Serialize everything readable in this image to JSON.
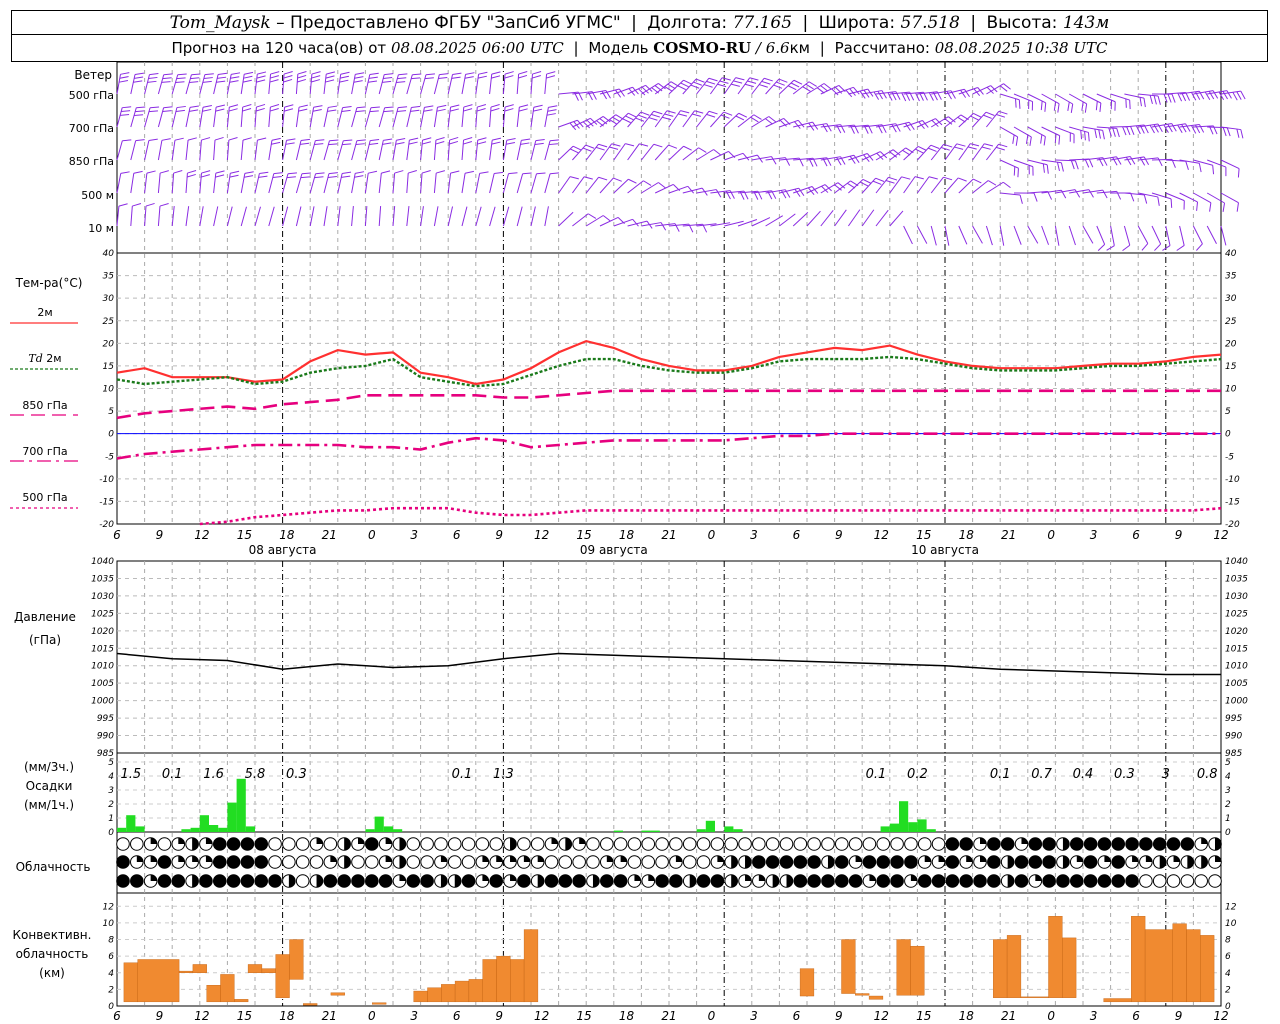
{
  "header": {
    "station": "Tom_Maysk",
    "provider": "– Предоставлено ФГБУ \"ЗапСиб УГМС\"",
    "lon_label": "Долгота:",
    "lon": "77.165",
    "lat_label": "Широта:",
    "lat": "57.518",
    "alt_label": "Высота:",
    "alt": "143м",
    "forecast_label": "Прогноз на 120 часа(ов) от",
    "forecast_from": "08.08.2025 06:00 UTC",
    "model_label": "Модель",
    "model_name": "COSMO-RU",
    "model_res": "/ 6.6",
    "model_res_unit": "км",
    "calc_label": "Рассчитано:",
    "calc_time": "08.08.2025 10:38 UTC"
  },
  "labels": {
    "wind": "Ветер",
    "wind_levels": [
      "500 гПа",
      "700 гПа",
      "850 гПа",
      "500 м",
      "10 м"
    ],
    "temp_title": "Тем-ра(°С)",
    "temp_2m": "2м",
    "td_2m_prefix": "Td",
    "td_2m": "2м",
    "t850": "850 гПа",
    "t700": "700 гПа",
    "t500": "500 гПа",
    "pressure": "Давление",
    "pressure_unit": "(гПа)",
    "precip_unit3": "(мм/3ч.)",
    "precip": "Осадки",
    "precip_unit1": "(мм/1ч.)",
    "cloud": "Облачность",
    "conv1": "Конвективн.",
    "conv2": "облачность",
    "conv3": "(км)"
  },
  "colors": {
    "wind": "#8a2be2",
    "t2m": "#ff3030",
    "td2m": "#1a7a1a",
    "t850": "#e6007e",
    "t700": "#e6007e",
    "t500": "#e6007e",
    "zero_line": "#0000ff",
    "pressure": "#000000",
    "precip": "#22dd22",
    "convective": "#f08a30"
  },
  "chart_data": [
    {
      "type": "line",
      "title": "Тем-ра(°С)",
      "x_hours": [
        0,
        3,
        6,
        9,
        12,
        15,
        18,
        21,
        24,
        27,
        30,
        33,
        36,
        39,
        42,
        45,
        48,
        51,
        54,
        57,
        60,
        63,
        66,
        69,
        72,
        75,
        78,
        81,
        84,
        87,
        90,
        93,
        96,
        99,
        102,
        105,
        108,
        111,
        114,
        117,
        120
      ],
      "x_tick_labels": [
        "6",
        "9",
        "12",
        "15",
        "18",
        "21",
        "0",
        "3",
        "6",
        "9",
        "12",
        "15",
        "18",
        "21",
        "0",
        "3",
        "6",
        "9",
        "12",
        "15",
        "18",
        "21",
        "0",
        "3",
        "6",
        "9",
        "12"
      ],
      "date_labels": [
        "08 августа",
        "09 августа",
        "10 августа"
      ],
      "ylim": [
        -20,
        40
      ],
      "y_ticks": [
        -20,
        -15,
        -10,
        -5,
        0,
        5,
        10,
        15,
        20,
        25,
        30,
        35,
        40
      ],
      "series": [
        {
          "name": "2м",
          "values": [
            13.5,
            14.5,
            12.5,
            12.5,
            12.5,
            11.5,
            12,
            16,
            18.5,
            17.5,
            18,
            13.5,
            12.5,
            11,
            12,
            14.5,
            18,
            20.5,
            19,
            16.5,
            15,
            14,
            14,
            15,
            17,
            18,
            19,
            18.5,
            19.5,
            17.5,
            16,
            15,
            14.5,
            14.5,
            14.5,
            15,
            15.5,
            15.5,
            16,
            17,
            17.5
          ]
        },
        {
          "name": "Td 2м",
          "values": [
            12,
            11,
            11.5,
            12,
            12.5,
            11,
            11.5,
            13.5,
            14.5,
            15,
            16.5,
            12.5,
            11.5,
            10.5,
            11,
            13,
            15,
            16.5,
            16.5,
            15,
            14,
            13.5,
            13.5,
            14.5,
            16,
            16.5,
            16.5,
            16.5,
            17,
            16.5,
            15.5,
            14.5,
            14,
            14,
            14,
            14.5,
            15,
            15,
            15.5,
            16,
            16.5
          ]
        },
        {
          "name": "850 гПа",
          "values": [
            3.5,
            4.5,
            5,
            5.5,
            6,
            5.5,
            6.5,
            7,
            7.5,
            8.5,
            8.5,
            8.5,
            8.5,
            8.5,
            8,
            8,
            8.5,
            9,
            9.5,
            9.5,
            9.5,
            9.5,
            9.5,
            9.5,
            9.5,
            9.5,
            9.5,
            9.5,
            9.5,
            9.5,
            9.5,
            9.5,
            9.5,
            9.5,
            9.5,
            9.5,
            9.5,
            9.5,
            9.5,
            9.5,
            9.5
          ]
        },
        {
          "name": "700 гПа",
          "values": [
            -5.5,
            -4.5,
            -4,
            -3.5,
            -3,
            -2.5,
            -2.5,
            -2.5,
            -2.5,
            -3,
            -3,
            -3.5,
            -2,
            -1,
            -1.5,
            -3,
            -2.5,
            -2,
            -1.5,
            -1.5,
            -1.5,
            -1.5,
            -1.5,
            -1,
            -0.5,
            -0.5,
            0,
            0,
            0,
            0,
            0,
            0,
            0,
            0,
            0,
            0,
            0,
            0,
            0,
            0,
            0
          ]
        },
        {
          "name": "500 гПа",
          "values": [
            null,
            null,
            null,
            -20,
            -19.5,
            -18.5,
            -18,
            -17.5,
            -17,
            -17,
            -16.5,
            -16.5,
            -16.5,
            -17.5,
            -18,
            -18,
            -17.5,
            -17,
            -17,
            -17,
            -17,
            -17,
            -17,
            -17,
            -17,
            -17,
            -17,
            -17,
            -17,
            -17,
            -17,
            -17,
            -17,
            -17,
            -17,
            -17,
            -17,
            -17,
            -17,
            -17,
            -16.5
          ]
        }
      ]
    },
    {
      "type": "line",
      "title": "Давление (гПа)",
      "x_hours": [
        0,
        6,
        12,
        18,
        24,
        30,
        36,
        42,
        48,
        54,
        60,
        66,
        72,
        78,
        84,
        90,
        96,
        102,
        108,
        114,
        120
      ],
      "ylim": [
        985,
        1040
      ],
      "y_ticks": [
        985,
        990,
        995,
        1000,
        1005,
        1010,
        1015,
        1020,
        1025,
        1030,
        1035,
        1040
      ],
      "series": [
        {
          "name": "Давление",
          "values": [
            1013.5,
            1012,
            1011.5,
            1009,
            1010.5,
            1009.5,
            1010,
            1012,
            1013.5,
            1013,
            1012.5,
            1012,
            1011.5,
            1011,
            1010.5,
            1010,
            1009,
            1008.5,
            1008,
            1007.5,
            1007.5
          ]
        }
      ]
    },
    {
      "type": "bar",
      "title": "Осадки (мм/1ч.)",
      "ylim": [
        0,
        5
      ],
      "y_ticks": [
        0,
        1,
        2,
        3,
        4,
        5
      ],
      "x_hours": [
        0,
        1,
        2,
        3,
        6,
        7,
        8,
        9,
        10,
        11,
        12,
        13,
        14,
        15,
        27,
        28,
        29,
        30,
        54,
        55,
        57,
        58,
        63,
        64,
        65,
        66,
        67,
        68,
        69,
        70,
        71,
        72,
        73,
        74,
        75,
        76,
        77,
        78,
        79,
        80,
        81,
        82,
        83,
        84,
        85,
        86,
        87,
        88,
        89,
        90,
        91,
        92,
        93,
        94,
        95,
        96,
        97,
        98,
        99,
        100,
        101,
        102,
        103,
        104,
        105,
        106,
        107,
        108,
        109,
        110,
        111,
        112,
        113,
        114,
        115,
        116,
        117,
        118,
        119
      ],
      "values": [
        0.3,
        1.2,
        0.4,
        0,
        0,
        0.2,
        0.3,
        1.2,
        0.5,
        0.3,
        2.1,
        3.8,
        0.4,
        0,
        0.2,
        1.1,
        0.4,
        0.2,
        0.1,
        0,
        0.1,
        0.1,
        0.2,
        0.8,
        0,
        0.4,
        0.2,
        0,
        0,
        0,
        0,
        0,
        0,
        0,
        0,
        0,
        0,
        0,
        0,
        0,
        0,
        0,
        0.4,
        0.6,
        2.2,
        0.7,
        0.9,
        0.2,
        0,
        0,
        0,
        0,
        0,
        0,
        0,
        0,
        0,
        0,
        0,
        0,
        0,
        0,
        0,
        0,
        0,
        0,
        0,
        0,
        0,
        0,
        0,
        0,
        0,
        0,
        0,
        0,
        0,
        0,
        0
      ],
      "totals_3h_labels": [
        "1.5",
        "0.1",
        "1.6",
        "5.8",
        "0.3",
        "0.1",
        "1.3",
        "0.1",
        "0.2",
        "0.1",
        "0.7",
        "0.4",
        "0.3",
        "3",
        "0.8"
      ],
      "totals_3h_hours": [
        1,
        4,
        7,
        10,
        13,
        25,
        28,
        55,
        58,
        64,
        67,
        70,
        73,
        76,
        79
      ]
    },
    {
      "type": "bar",
      "title": "Конвективн. облачность (км)",
      "ylim": [
        0,
        13
      ],
      "y_ticks": [
        0,
        2,
        4,
        6,
        8,
        10,
        12
      ],
      "bars": [
        {
          "x0": 0.5,
          "x1": 1.5,
          "bot": 0.5,
          "top": 5.2
        },
        {
          "x0": 1.5,
          "x1": 4.5,
          "bot": 0.5,
          "top": 5.6
        },
        {
          "x0": 4.5,
          "x1": 5.5,
          "bot": 4.0,
          "top": 4.2
        },
        {
          "x0": 5.5,
          "x1": 6.5,
          "bot": 4.0,
          "top": 5.0
        },
        {
          "x0": 6.5,
          "x1": 7.5,
          "bot": 0.5,
          "top": 2.5
        },
        {
          "x0": 7.5,
          "x1": 8.5,
          "bot": 0.5,
          "top": 3.8
        },
        {
          "x0": 8.5,
          "x1": 9.5,
          "bot": 0.5,
          "top": 0.8
        },
        {
          "x0": 9.5,
          "x1": 10.5,
          "bot": 4.0,
          "top": 5.0
        },
        {
          "x0": 10.5,
          "x1": 11.5,
          "bot": 4.0,
          "top": 4.5
        },
        {
          "x0": 11.5,
          "x1": 12.5,
          "bot": 1.0,
          "top": 6.2
        },
        {
          "x0": 12.5,
          "x1": 13.5,
          "bot": 3.2,
          "top": 8.0
        },
        {
          "x0": 13.5,
          "x1": 14.5,
          "bot": 0.1,
          "top": 0.3
        },
        {
          "x0": 15.5,
          "x1": 16.5,
          "bot": 1.3,
          "top": 1.6
        },
        {
          "x0": 18.5,
          "x1": 19.5,
          "bot": 0.2,
          "top": 0.4
        },
        {
          "x0": 21.5,
          "x1": 22.5,
          "bot": 0.5,
          "top": 1.8
        },
        {
          "x0": 22.5,
          "x1": 23.5,
          "bot": 0.5,
          "top": 2.2
        },
        {
          "x0": 23.5,
          "x1": 24.5,
          "bot": 0.5,
          "top": 2.6
        },
        {
          "x0": 24.5,
          "x1": 25.5,
          "bot": 0.5,
          "top": 3.0
        },
        {
          "x0": 25.5,
          "x1": 26.5,
          "bot": 0.5,
          "top": 3.2
        },
        {
          "x0": 26.5,
          "x1": 27.5,
          "bot": 0.5,
          "top": 5.6
        },
        {
          "x0": 27.5,
          "x1": 28.5,
          "bot": 0.5,
          "top": 6.0
        },
        {
          "x0": 28.5,
          "x1": 29.5,
          "bot": 0.5,
          "top": 5.6
        },
        {
          "x0": 29.5,
          "x1": 30.5,
          "bot": 0.5,
          "top": 9.2
        },
        {
          "x0": 49.5,
          "x1": 50.5,
          "bot": 1.2,
          "top": 4.5
        },
        {
          "x0": 52.5,
          "x1": 53.5,
          "bot": 1.5,
          "top": 8.0
        },
        {
          "x0": 53.5,
          "x1": 54.5,
          "bot": 1.3,
          "top": 1.5
        },
        {
          "x0": 54.5,
          "x1": 55.5,
          "bot": 0.8,
          "top": 1.2
        },
        {
          "x0": 56.5,
          "x1": 57.5,
          "bot": 1.3,
          "top": 8.0
        },
        {
          "x0": 57.5,
          "x1": 58.5,
          "bot": 1.3,
          "top": 7.2
        },
        {
          "x0": 63.5,
          "x1": 64.5,
          "bot": 1.0,
          "top": 8.0
        },
        {
          "x0": 64.5,
          "x1": 65.5,
          "bot": 1.0,
          "top": 8.5
        },
        {
          "x0": 65.5,
          "x1": 67.5,
          "bot": 1.0,
          "top": 1.1
        },
        {
          "x0": 67.5,
          "x1": 68.5,
          "bot": 1.0,
          "top": 10.8
        },
        {
          "x0": 68.5,
          "x1": 69.5,
          "bot": 1.0,
          "top": 8.2
        },
        {
          "x0": 71.5,
          "x1": 73.5,
          "bot": 0.5,
          "top": 0.9
        },
        {
          "x0": 73.5,
          "x1": 74.5,
          "bot": 0.5,
          "top": 10.8
        },
        {
          "x0": 74.5,
          "x1": 76.5,
          "bot": 0.5,
          "top": 9.2
        },
        {
          "x0": 76.5,
          "x1": 77.5,
          "bot": 0.5,
          "top": 9.9
        },
        {
          "x0": 77.5,
          "x1": 78.5,
          "bot": 0.5,
          "top": 9.2
        },
        {
          "x0": 78.5,
          "x1": 79.5,
          "bot": 0.5,
          "top": 8.5
        }
      ]
    }
  ],
  "cloud_rows": [
    "ooqoqhqwwwwoooqohqwqhooooooohooqhqoooooooooooooooooooooooooowwqwwqwwhwwwwwwwwwqhwwww",
    "wqqwqqqwwwwooooqhooqhooqooqqqqqooooqqoooqooqhhwwwwwhwqwwwwqqwqqwhwwwhqwqwqqhqhhqw",
    "wwqwwhwwwwwwhohwwwwwqwwhhwqwqwhwwwhwwqqwwhwwhqqhhwwwwwqwwqwwwwwwhwqwwwwwwwoooooo"
  ]
}
